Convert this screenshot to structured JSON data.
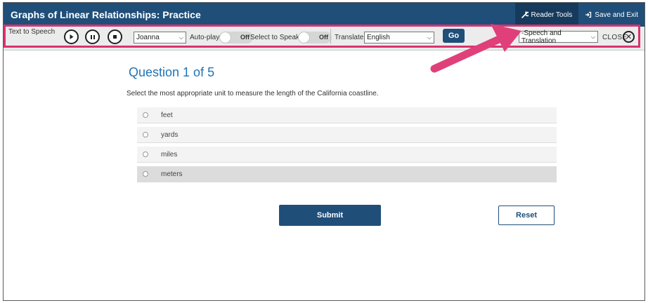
{
  "header": {
    "title": "Graphs of Linear Relationships: Practice",
    "reader_tools_label": "Reader Tools",
    "save_exit_label": "Save and Exit"
  },
  "toolbar": {
    "tts_label": "Text to Speech",
    "voice": "Joanna",
    "autoplay_label": "Auto-play:",
    "autoplay_state": "Off",
    "select_to_speak_label": "Select to Speak:",
    "select_to_speak_state": "Off",
    "translate_label": "Translate",
    "language": "English",
    "go_label": "Go",
    "tool_mode": "-Speech and Translation",
    "close_label": "CLOSE",
    "close_icon": "✕"
  },
  "question": {
    "title": "Question 1 of 5",
    "prompt": "Select the most appropriate unit to measure the length of the California coastline.",
    "options": [
      "feet",
      "yards",
      "miles",
      "meters"
    ],
    "selected_index": 3
  },
  "actions": {
    "submit_label": "Submit",
    "reset_label": "Reset"
  },
  "colors": {
    "header_bg": "#1f4e79",
    "accent": "#1f74b5",
    "highlight": "#d8336e"
  }
}
